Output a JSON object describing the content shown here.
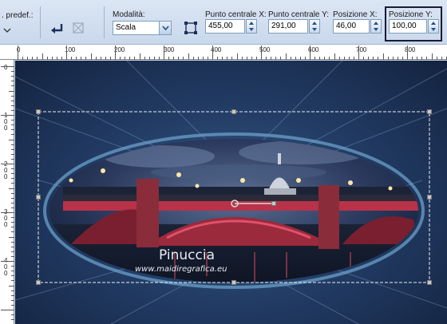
{
  "toolbar": {
    "preset_label": ". predef.:",
    "mode_label": "Modalità:",
    "mode_value": "Scala",
    "center_x_label": "Punto centrale X:",
    "center_x_value": "455,00",
    "center_y_label": "Punto centrale Y:",
    "center_y_value": "291,00",
    "pos_x_label": "Posizione X:",
    "pos_x_value": "46,00",
    "pos_y_label": "Posizione Y:",
    "pos_y_value": "100,00"
  },
  "ruler_top": [
    "0",
    "100",
    "200",
    "300",
    "400",
    "500",
    "600",
    "700",
    "800"
  ],
  "ruler_left": [
    "0",
    "1 0 0",
    "2 0 0",
    "3 0 0",
    "4 0 0"
  ],
  "canvas": {
    "watermark_name": "Pinuccia",
    "watermark_url": "www.maidiregrafica.eu"
  },
  "colors": {
    "selection_highlight": "#1b1b33",
    "accent_bridge": "#d23a4a"
  },
  "icons": [
    "undo-icon",
    "crop-icon",
    "dropdown-arrow-icon",
    "transform-icon",
    "spinner-icon",
    "help-icon"
  ]
}
